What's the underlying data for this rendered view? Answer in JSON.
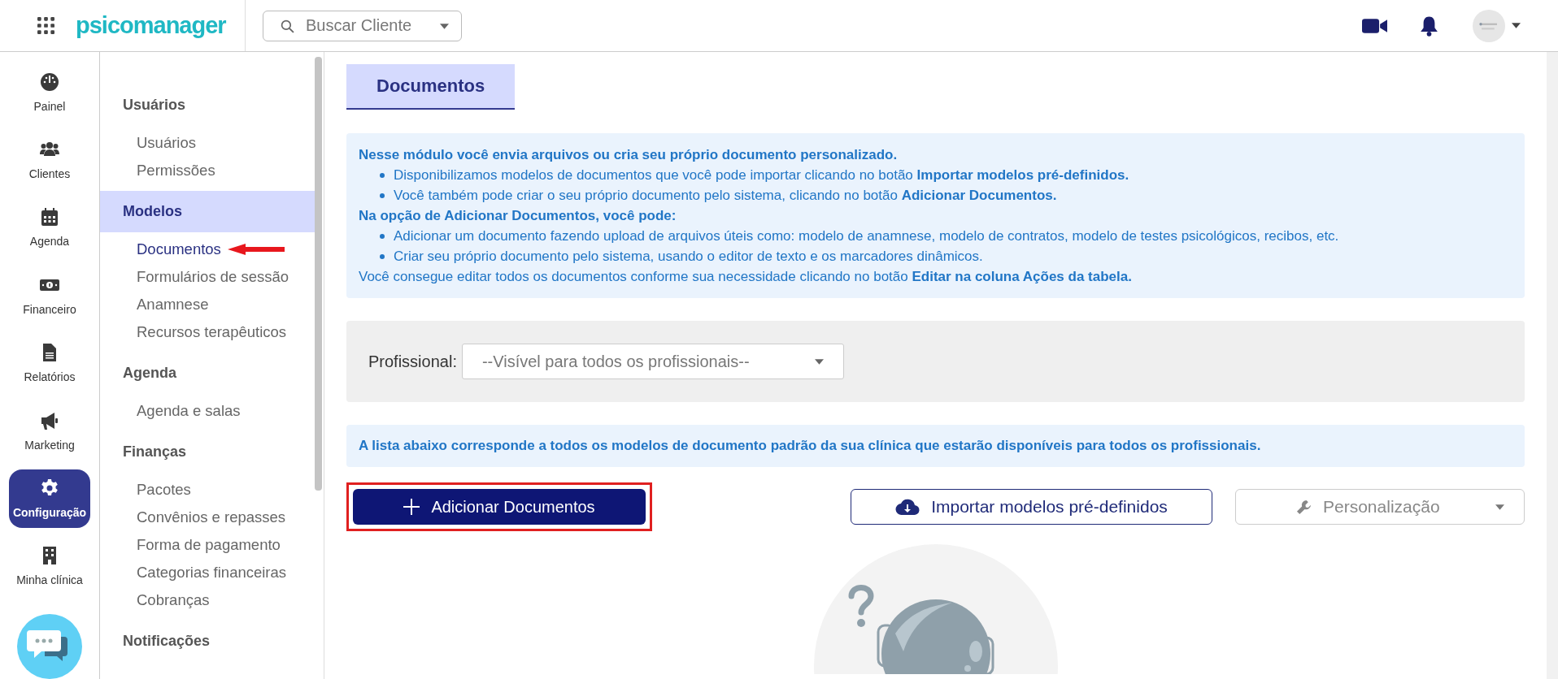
{
  "header": {
    "logo": "psicomanager",
    "search": {
      "placeholder": "Buscar Cliente"
    }
  },
  "rail": [
    {
      "label": "Painel",
      "selected": false
    },
    {
      "label": "Clientes",
      "selected": false
    },
    {
      "label": "Agenda",
      "selected": false
    },
    {
      "label": "Financeiro",
      "selected": false
    },
    {
      "label": "Relatórios",
      "selected": false
    },
    {
      "label": "Marketing",
      "selected": false
    },
    {
      "label": "Configuração",
      "selected": true
    },
    {
      "label": "Minha clínica",
      "selected": false
    }
  ],
  "settings_menu": [
    {
      "heading": "Usuários",
      "selected": false,
      "items": [
        {
          "label": "Usuários",
          "selected": false
        },
        {
          "label": "Permissões",
          "selected": false
        }
      ]
    },
    {
      "heading": "Modelos",
      "selected": true,
      "items": [
        {
          "label": "Documentos",
          "selected": true,
          "annotated": true
        },
        {
          "label": "Formulários de sessão",
          "selected": false,
          "annotated": false
        },
        {
          "label": "Anamnese",
          "selected": false,
          "annotated": false
        },
        {
          "label": "Recursos terapêuticos",
          "selected": false,
          "annotated": false
        }
      ]
    },
    {
      "heading": "Agenda",
      "selected": false,
      "items": [
        {
          "label": "Agenda e salas",
          "selected": false
        }
      ]
    },
    {
      "heading": "Finanças",
      "selected": false,
      "items": [
        {
          "label": "Pacotes",
          "selected": false
        },
        {
          "label": "Convênios e repasses",
          "selected": false
        },
        {
          "label": "Forma de pagamento",
          "selected": false
        },
        {
          "label": "Categorias financeiras",
          "selected": false
        },
        {
          "label": "Cobranças",
          "selected": false
        }
      ]
    },
    {
      "heading": "Notificações",
      "selected": false
    }
  ],
  "tab": {
    "label": "Documentos",
    "selected": true
  },
  "info": [
    {
      "kind": "heading",
      "text": "Nesse módulo você envia arquivos ou cria seu próprio documento personalizado."
    },
    {
      "kind": "bullet",
      "text": "Disponibilizamos modelos de documentos que você pode importar clicando no botão **Importar modelos pré-definidos.**"
    },
    {
      "kind": "bullet",
      "text": "Você também pode criar o seu próprio documento pelo sistema, clicando no botão **Adicionar Documentos.**"
    },
    {
      "kind": "heading",
      "text": "Na opção de Adicionar Documentos, você pode:"
    },
    {
      "kind": "bullet",
      "text": "Adicionar um documento fazendo upload de arquivos úteis como: modelo de anamnese, modelo de contratos, modelo de testes psicológicos, recibos, etc."
    },
    {
      "kind": "bullet",
      "text": "Criar seu próprio documento pelo sistema, usando o editor de texto e os marcadores dinâmicos."
    },
    {
      "kind": "plain",
      "text": "Você consegue editar todos os documentos conforme sua necessidade clicando no botão **Editar na coluna Ações da tabela.**"
    }
  ],
  "filter": {
    "label": "Profissional:",
    "value": "--Visível para todos os profissionais--"
  },
  "notice": "A lista abaixo corresponde a todos os modelos de documento padrão da sua clínica que estarão disponíveis para todos os profissionais.",
  "buttons": {
    "add": {
      "label": "Adicionar Documentos",
      "highlighted": true
    },
    "import": {
      "label": "Importar modelos pré-definidos"
    },
    "customize": {
      "label": "Personalização"
    }
  }
}
